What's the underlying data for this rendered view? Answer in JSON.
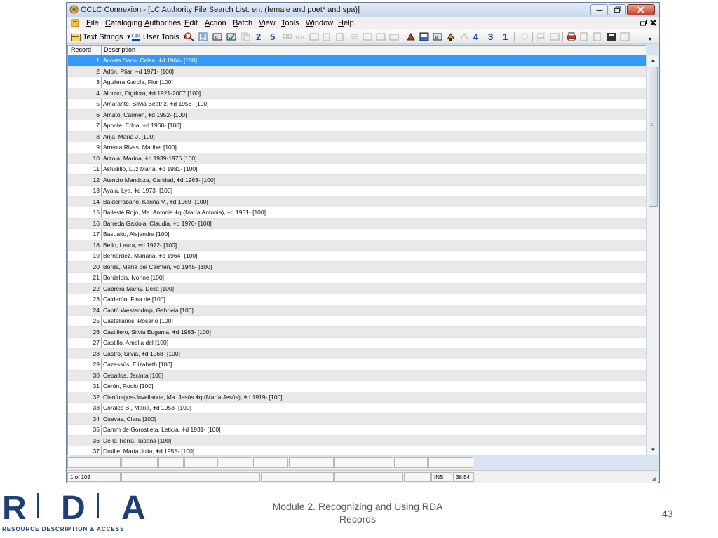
{
  "window": {
    "title": "OCLC Connexion - [LC Authority File Search List: en: (female and poet* and spa)]"
  },
  "menu": [
    {
      "label": "File",
      "name": "menu-file"
    },
    {
      "label": "Cataloging",
      "name": "menu-cataloging"
    },
    {
      "label": "Authorities",
      "name": "menu-authorities"
    },
    {
      "label": "Edit",
      "name": "menu-edit"
    },
    {
      "label": "Action",
      "name": "menu-action"
    },
    {
      "label": "Batch",
      "name": "menu-batch"
    },
    {
      "label": "View",
      "name": "menu-view"
    },
    {
      "label": "Tools",
      "name": "menu-tools"
    },
    {
      "label": "Window",
      "name": "menu-window"
    },
    {
      "label": "Help",
      "name": "menu-help"
    }
  ],
  "toolbar": {
    "text_strings": "Text Strings",
    "user_tools": "User Tools",
    "numbers": [
      "2",
      "5",
      "4",
      "3",
      "1"
    ]
  },
  "grid": {
    "col_record": "Record",
    "col_description": "Description",
    "rows": [
      [
        "1",
        "Acosta Seco, Celsa, ǂd 1964- [100]"
      ],
      [
        "2",
        "Adón, Pilar, ǂd 1971- [100]"
      ],
      [
        "3",
        "Aguilera García, Flor [100]"
      ],
      [
        "4",
        "Alonso, Digdora, ǂd 1921-2007 [100]"
      ],
      [
        "5",
        "Amarante, Silvia Beatriz, ǂd 1958- [100]"
      ],
      [
        "6",
        "Amato, Carmen, ǂd 1952- [100]"
      ],
      [
        "7",
        "Aponte, Edna, ǂd 1968- [100]"
      ],
      [
        "8",
        "Arija, María J. [100]"
      ],
      [
        "9",
        "Arreola Rivas, Maribel [100]"
      ],
      [
        "10",
        "Arzola, Marina, ǂd 1939-1976 [100]"
      ],
      [
        "11",
        "Astudillo, Luz María, ǂd 1981- [100]"
      ],
      [
        "12",
        "Atencio Mendoza, Caridad, ǂd 1963- [100]"
      ],
      [
        "13",
        "Ayala, Lya, ǂd 1973- [100]"
      ],
      [
        "14",
        "Balderrábano, Karina V., ǂd 1969- [100]"
      ],
      [
        "15",
        "Ballesté Rojo, Ma. Antonia ǂq (María Antonia), ǂd 1951- [100]"
      ],
      [
        "16",
        "Barreda Gaxiola, Claudia, ǂd 1970- [100]"
      ],
      [
        "17",
        "Basualto, Alejandra [100]"
      ],
      [
        "18",
        "Bello, Laura, ǂd 1972- [100]"
      ],
      [
        "19",
        "Bernárdez, Mariana, ǂd 1964- [100]"
      ],
      [
        "20",
        "Borda, María del Carmen, ǂd 1945- [100]"
      ],
      [
        "21",
        "Bordelois, Ivonne [100]"
      ],
      [
        "22",
        "Cabrera Marky, Delia [100]"
      ],
      [
        "23",
        "Calderón, Fina de [100]"
      ],
      [
        "24",
        "Cantú Westendarp, Gabriela [100]"
      ],
      [
        "25",
        "Castellanos, Rosario [100]"
      ],
      [
        "26",
        "Castillero, Silvia Eugenia, ǂd 1963- [100]"
      ],
      [
        "27",
        "Castillo, Amelia del [100]"
      ],
      [
        "28",
        "Castro, Silvia, ǂd 1968- [100]"
      ],
      [
        "29",
        "Cazessús, Elizabeth [100]"
      ],
      [
        "30",
        "Ceballos, Jacinta [100]"
      ],
      [
        "31",
        "Cerón, Rocío [100]"
      ],
      [
        "32",
        "Cienfuegos-Jovellanos, Ma. Jesús ǂq (María Jesús), ǂd 1919- [100]"
      ],
      [
        "33",
        "Corales B., María, ǂd 1953- [100]"
      ],
      [
        "34",
        "Cuevas, Clara [100]"
      ],
      [
        "35",
        "Damm de Gorostieta, Leticia, ǂd 1931- [100]"
      ],
      [
        "36",
        "De la Tierra, Tatiana [100]"
      ],
      [
        "37",
        "Druille, María Julia, ǂd 1955- [100]"
      ]
    ]
  },
  "status": {
    "position": "1 of 102",
    "mode": "INS",
    "time": "38:54"
  },
  "footer": {
    "logo_letters": [
      "R",
      "D",
      "A"
    ],
    "logo_tagline": "RESOURCE DESCRIPTION & ACCESS",
    "line1": "Module 2. Recognizing and Using RDA",
    "line2": "Records",
    "page_number": "43"
  },
  "colors": {
    "selection": "#3399ff",
    "brand": "#1f3f73"
  }
}
